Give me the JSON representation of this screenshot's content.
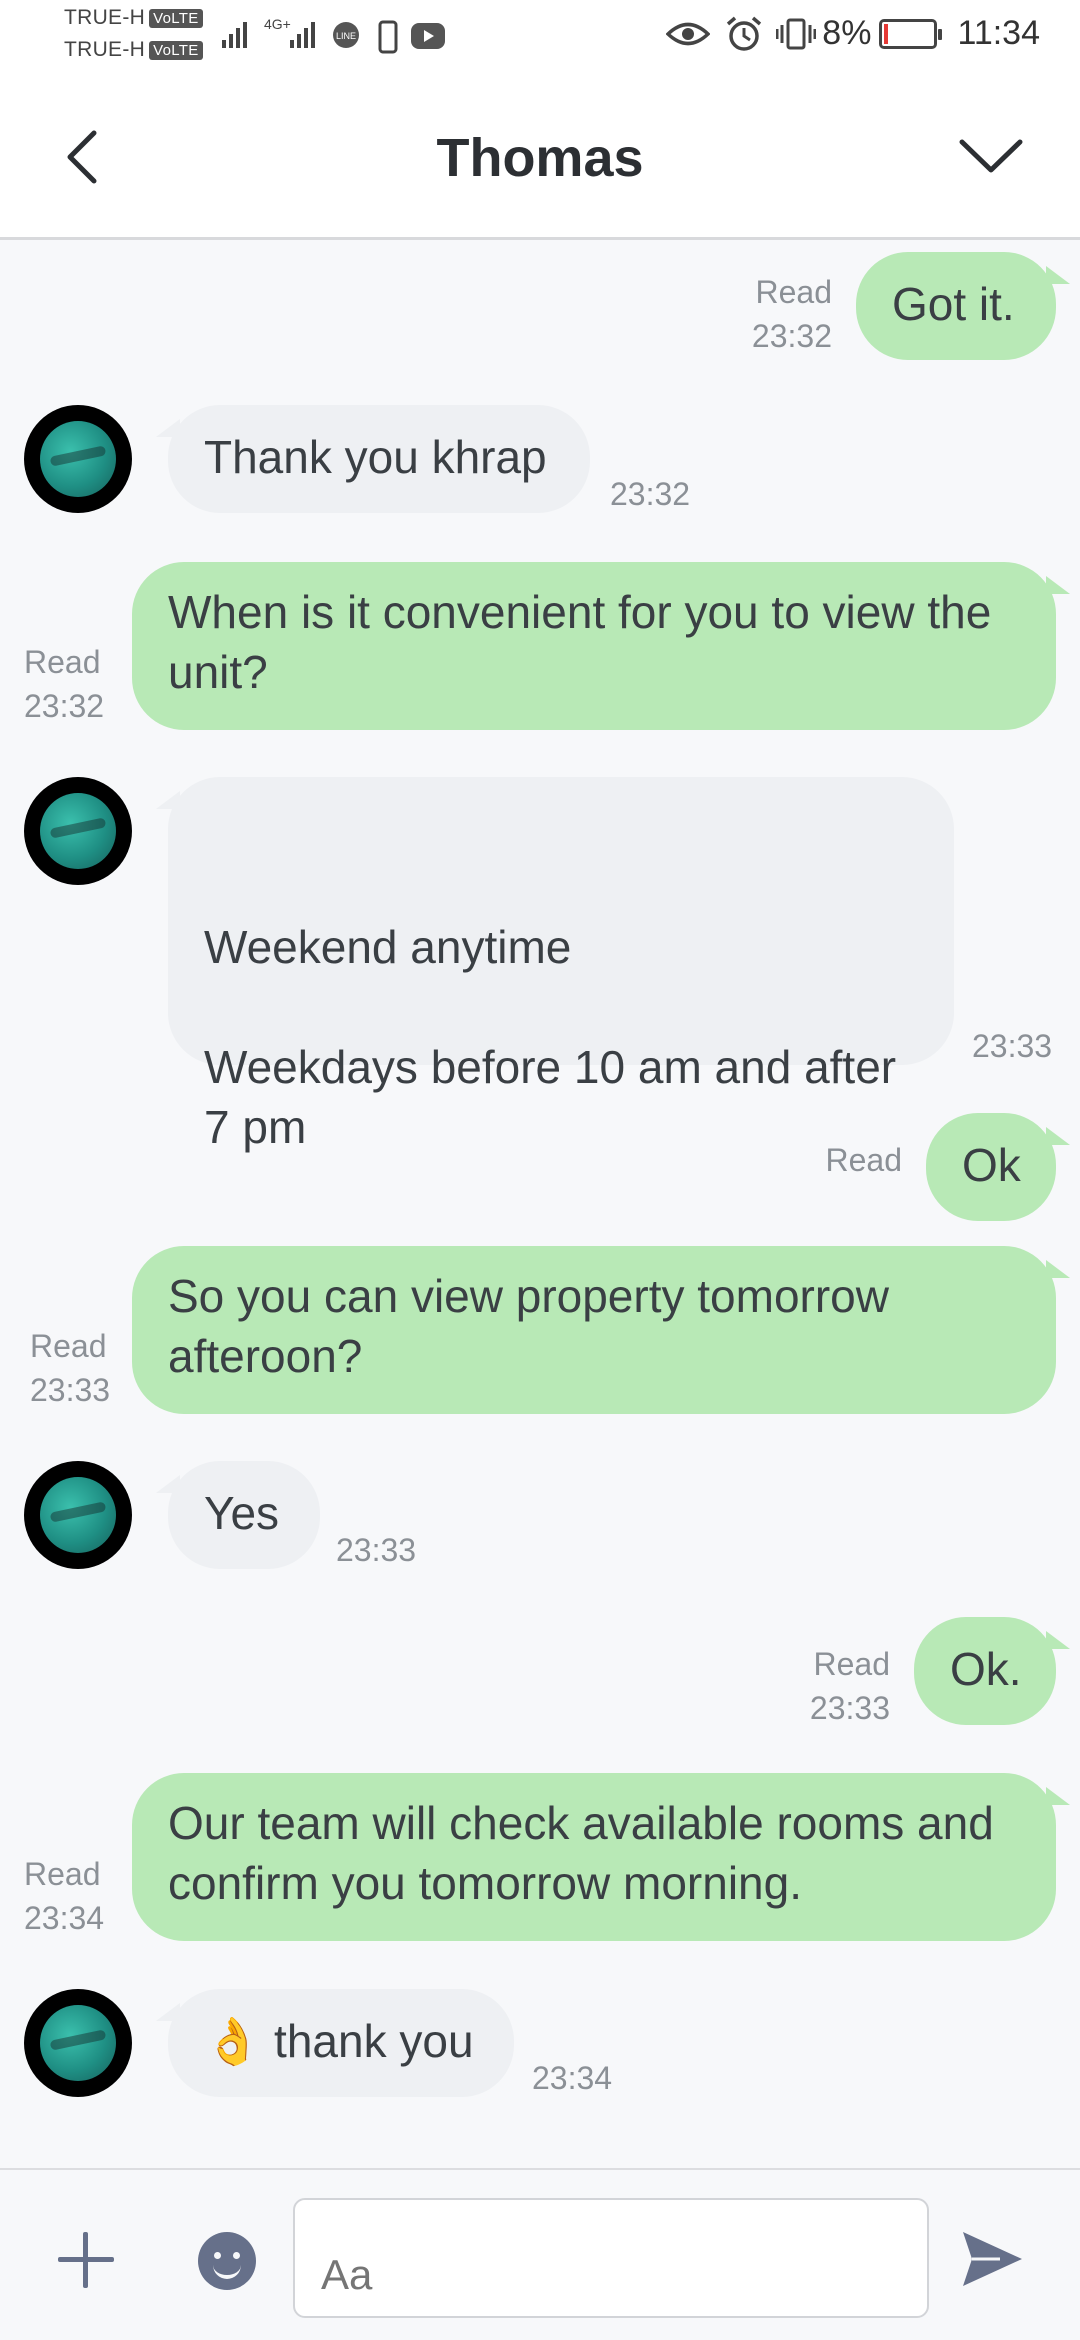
{
  "status_bar": {
    "carrier1": "TRUE-H",
    "carrier2": "TRUE-H",
    "volte": "VoLTE",
    "network": "4G+",
    "battery_percent": "8%",
    "time": "11:34"
  },
  "header": {
    "title": "Thomas"
  },
  "messages": [
    {
      "dir": "out",
      "text": "Got it.",
      "status": "Read",
      "time": "23:32"
    },
    {
      "dir": "in",
      "text": "Thank you khrap",
      "time": "23:32"
    },
    {
      "dir": "out",
      "text": "When is it convenient for you to view the unit?",
      "status": "Read",
      "time": "23:32"
    },
    {
      "dir": "in",
      "text": "Weekend anytime\n\nWeekdays before 10 am and after 7 pm",
      "time": "23:33"
    },
    {
      "dir": "out",
      "text": "Ok",
      "status": "Read",
      "time": ""
    },
    {
      "dir": "out",
      "text": "So you can view property tomorrow afteroon?",
      "status": "Read",
      "time": "23:33"
    },
    {
      "dir": "in",
      "text": "Yes",
      "time": "23:33"
    },
    {
      "dir": "out",
      "text": "Ok.",
      "status": "Read",
      "time": "23:33"
    },
    {
      "dir": "out",
      "text": "Our team will check available rooms and confirm you tomorrow morning.",
      "status": "Read",
      "time": "23:34"
    },
    {
      "dir": "in",
      "text": "👌 thank you",
      "time": "23:34"
    }
  ],
  "input": {
    "placeholder": "Aa"
  },
  "colors": {
    "outgoing_bubble": "#b8e9b6",
    "incoming_bubble": "#eef0f3",
    "icon_gray": "#66708a"
  }
}
